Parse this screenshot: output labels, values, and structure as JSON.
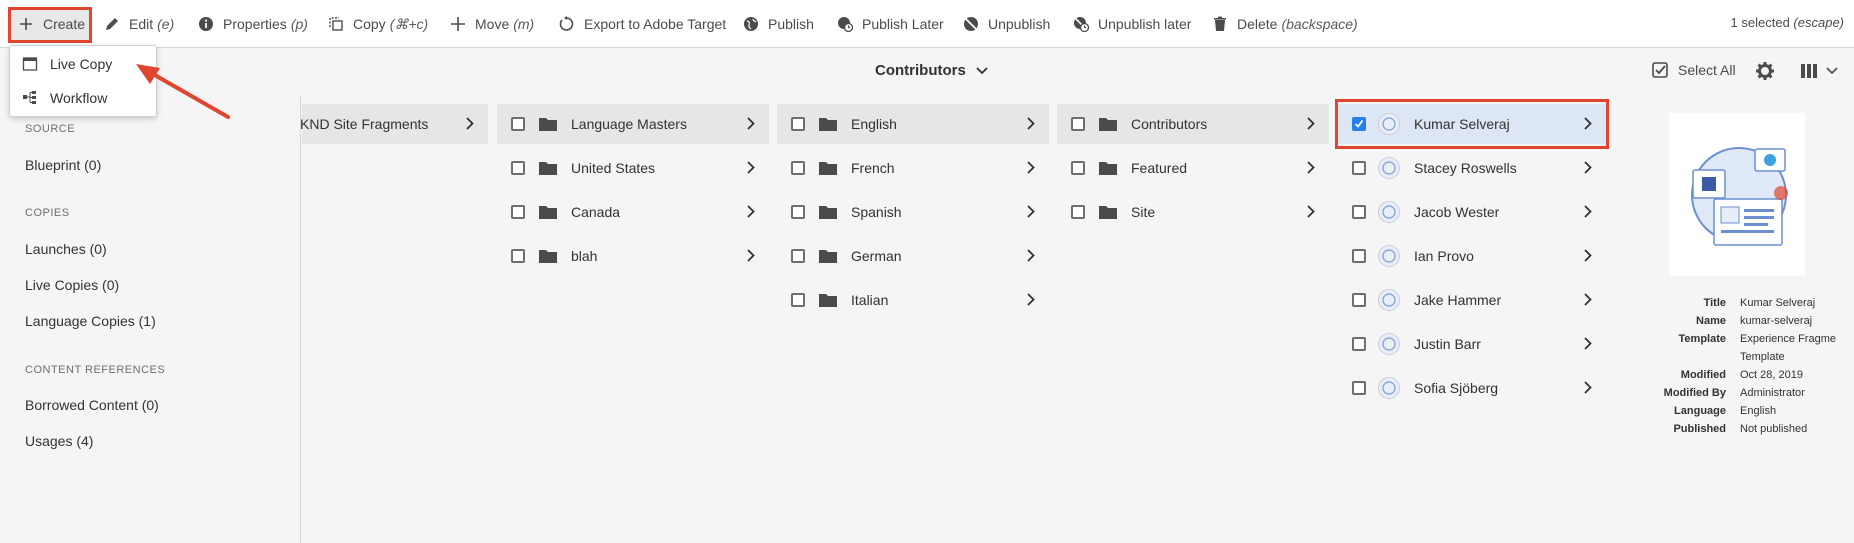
{
  "toolbar": {
    "create": "Create",
    "edit": "Edit",
    "edit_sc": "(e)",
    "properties": "Properties",
    "properties_sc": "(p)",
    "copy": "Copy",
    "copy_sc": "(⌘+c)",
    "move": "Move",
    "move_sc": "(m)",
    "export": "Export to Adobe Target",
    "publish": "Publish",
    "publish_later": "Publish Later",
    "unpublish": "Unpublish",
    "unpublish_later": "Unpublish later",
    "delete": "Delete",
    "delete_sc": "(backspace)",
    "selected": "1 selected",
    "selected_sc": "(escape)"
  },
  "create_menu": {
    "items": [
      "Live Copy",
      "Workflow"
    ]
  },
  "header": {
    "breadcrumb": "Contributors",
    "select_all": "Select All"
  },
  "rail": {
    "source_title": "SOURCE",
    "blueprint": "Blueprint (0)",
    "copies_title": "COPIES",
    "launches": "Launches (0)",
    "live_copies": "Live Copies (0)",
    "language_copies": "Language Copies (1)",
    "refs_title": "CONTENT REFERENCES",
    "borrowed": "Borrowed Content (0)",
    "usages": "Usages (4)"
  },
  "columns": {
    "col1": [
      "KND Site Fragments"
    ],
    "col2": [
      "Language Masters",
      "United States",
      "Canada",
      "blah"
    ],
    "col3": [
      "English",
      "French",
      "Spanish",
      "German",
      "Italian"
    ],
    "col4": [
      "Contributors",
      "Featured",
      "Site"
    ],
    "col5": [
      "Kumar Selveraj",
      "Stacey Roswells",
      "Jacob Wester",
      "Ian Provo",
      "Jake Hammer",
      "Justin Barr",
      "Sofia Sjöberg"
    ]
  },
  "details": {
    "title_k": "Title",
    "title_v": "Kumar Selveraj",
    "name_k": "Name",
    "name_v": "kumar-selveraj",
    "template_k": "Template",
    "template_v1": "Experience Fragme",
    "template_v2": "Template",
    "modified_k": "Modified",
    "modified_v": "Oct 28, 2019",
    "modifiedby_k": "Modified By",
    "modifiedby_v": "Administrator",
    "language_k": "Language",
    "language_v": "English",
    "published_k": "Published",
    "published_v": "Not published"
  },
  "colors": {
    "highlight": "#e0462f",
    "selection": "#2680eb"
  }
}
